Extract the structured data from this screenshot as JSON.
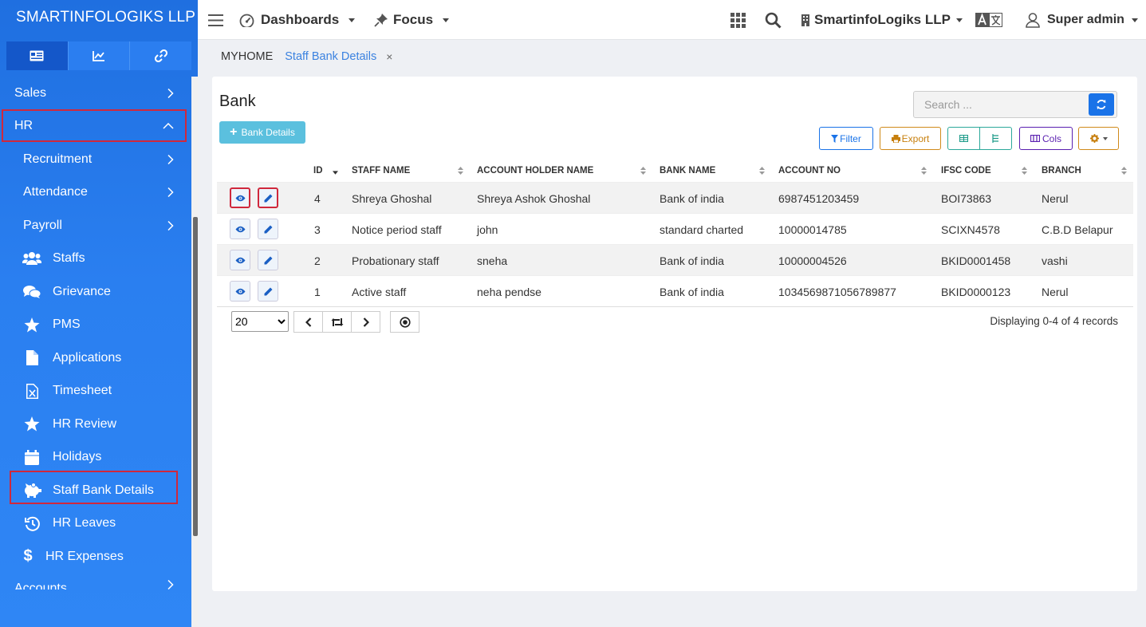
{
  "brand": "SMARTINFOLOGIKS LLP",
  "sidebar": {
    "items": [
      {
        "label": "Sales",
        "icon": "chevron-right-icon"
      },
      {
        "label": "HR",
        "icon": "chevron-up-icon"
      },
      {
        "label": "Recruitment",
        "icon": "chevron-right-icon"
      },
      {
        "label": "Attendance",
        "icon": "chevron-right-icon"
      },
      {
        "label": "Payroll",
        "icon": "chevron-right-icon"
      },
      {
        "label": "Staffs",
        "icon": "users-icon"
      },
      {
        "label": "Grievance",
        "icon": "comments-icon"
      },
      {
        "label": "PMS",
        "icon": "star-icon"
      },
      {
        "label": "Applications",
        "icon": "file-icon"
      },
      {
        "label": "Timesheet",
        "icon": "excel-file-icon"
      },
      {
        "label": "HR Review",
        "icon": "star-icon"
      },
      {
        "label": "Holidays",
        "icon": "calendar-icon"
      },
      {
        "label": "Staff Bank Details",
        "icon": "piggy-bank-icon"
      },
      {
        "label": "HR Leaves",
        "icon": "history-icon"
      },
      {
        "label": "HR Expenses",
        "icon": "dollar-icon"
      },
      {
        "label": "Accounts",
        "icon": "chevron-right-icon"
      }
    ]
  },
  "topbar": {
    "dashboards": "Dashboards",
    "focus": "Focus",
    "company": "SmartinfoLogiks LLP",
    "user": "Super admin"
  },
  "breadcrumb": {
    "home": "MYHOME",
    "current": "Staff Bank Details",
    "close": "×"
  },
  "page": {
    "title": "Bank",
    "add_button": "Bank Details",
    "search_placeholder": "Search ...",
    "filter": "Filter",
    "export": "Export",
    "cols": "Cols"
  },
  "table": {
    "columns": [
      "ID",
      "STAFF NAME",
      "ACCOUNT HOLDER NAME",
      "BANK NAME",
      "ACCOUNT NO",
      "IFSC CODE",
      "BRANCH"
    ],
    "rows": [
      {
        "id": "4",
        "staff_name": "Shreya Ghoshal",
        "holder": "Shreya Ashok Ghoshal",
        "bank": "Bank of india",
        "account": "6987451203459",
        "ifsc": "BOI73863",
        "branch": "Nerul"
      },
      {
        "id": "3",
        "staff_name": "Notice period staff",
        "holder": "john",
        "bank": "standard charted",
        "account": "10000014785",
        "ifsc": "SCIXN4578",
        "branch": "C.B.D Belapur"
      },
      {
        "id": "2",
        "staff_name": "Probationary staff",
        "holder": "sneha",
        "bank": "Bank of india",
        "account": "10000004526",
        "ifsc": "BKID0001458",
        "branch": "vashi"
      },
      {
        "id": "1",
        "staff_name": "Active staff",
        "holder": "neha pendse",
        "bank": "Bank of india",
        "account": "1034569871056789877",
        "ifsc": "BKID0000123",
        "branch": "Nerul"
      }
    ]
  },
  "pager": {
    "page_size": "20",
    "info": "Displaying 0-4 of 4 records"
  },
  "colors": {
    "sidebar": "#2a7ff0",
    "highlight": "#d0283c",
    "accent": "#1a73e8"
  }
}
